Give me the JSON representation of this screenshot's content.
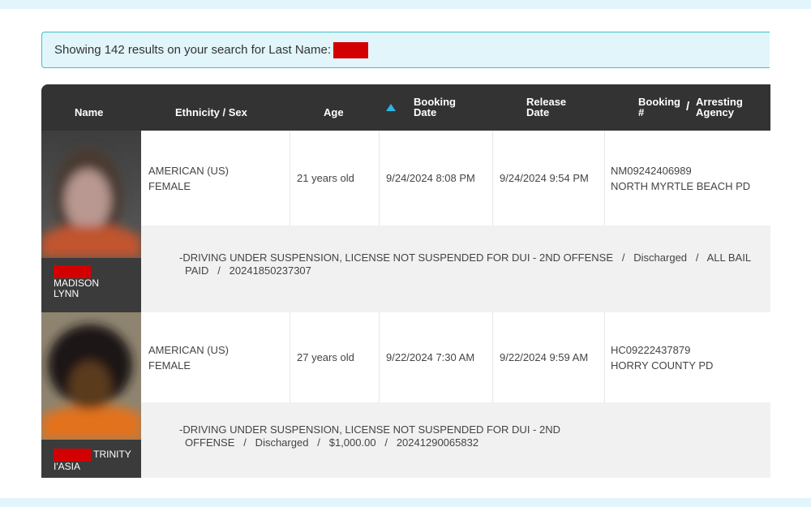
{
  "banner": {
    "text": "Showing 142 results on your search for Last Name:",
    "redacted_value": ""
  },
  "table": {
    "headers": {
      "name": "Name",
      "ethnicity_sex": "Ethnicity / Sex",
      "age": "Age",
      "booking_date_1": "Booking",
      "booking_date_2": "Date",
      "release_date_1": "Release",
      "release_date_2": "Date",
      "booking_no_1": "Booking",
      "booking_no_2": "#",
      "separator": "/",
      "agency_1": "Arresting",
      "agency_2": "Agency"
    },
    "sort": {
      "column": "booking_date",
      "direction": "ascending-icon"
    },
    "rows": [
      {
        "first_names_line1": "MADISON",
        "first_names_line2": "LYNN",
        "ethnicity": "AMERICAN (US)",
        "sex": "FEMALE",
        "age": "21 years old",
        "booking_date": "9/24/2024 8:08 PM",
        "release_date": "9/24/2024 9:54 PM",
        "booking_number": "NM09242406989",
        "agency": "NORTH MYRTLE BEACH PD",
        "charge_line1": "-DRIVING UNDER SUSPENSION, LICENSE NOT SUSPENDED FOR DUI - 2ND OFFENSE   /   Discharged   /   ALL BAIL",
        "charge_line2": "PAID   /   20241850237307"
      },
      {
        "first_names_line1": "TRINITY",
        "first_names_line2": "I'ASIA",
        "ethnicity": "AMERICAN (US)",
        "sex": "FEMALE",
        "age": "27 years old",
        "booking_date": "9/22/2024 7:30 AM",
        "release_date": "9/22/2024 9:59 AM",
        "booking_number": "HC09222437879",
        "agency": "HORRY COUNTY PD",
        "charge_line1": "-DRIVING UNDER SUSPENSION, LICENSE NOT SUSPENDED FOR DUI - 2ND",
        "charge_line2": "OFFENSE   /   Discharged   /   $1,000.00   /   20241290065832"
      }
    ]
  },
  "colors": {
    "header_bg": "#333333",
    "accent_sort": "#2bb4e6",
    "banner_bg": "#e1f5fb",
    "banner_border": "#3cc0cc",
    "redaction": "#d20000"
  }
}
